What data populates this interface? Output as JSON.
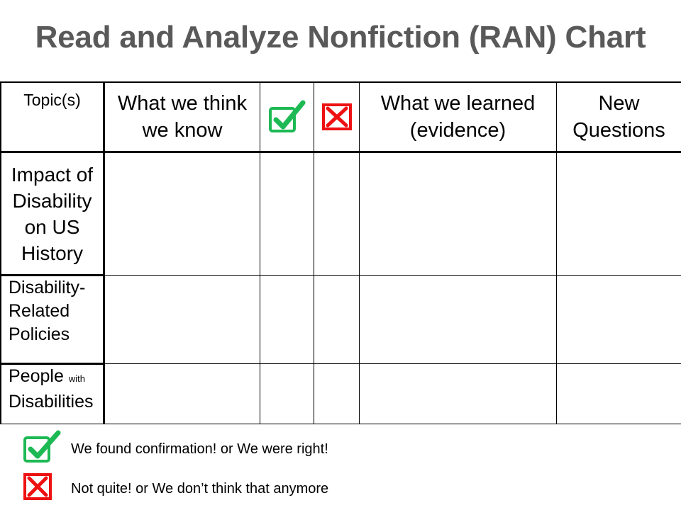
{
  "title": "Read and Analyze Nonfiction (RAN) Chart",
  "table": {
    "headers": {
      "topics": "Topic(s)",
      "think_line1": "What we think",
      "think_line2": "we know",
      "confirmed_icon": "green-check-box-icon",
      "rejected_icon": "red-x-box-icon",
      "learned_line1": "What we learned",
      "learned_line2": "(evidence)",
      "questions_line1": "New",
      "questions_line2": "Questions"
    },
    "rows": [
      {
        "topic_lines": [
          "Impact of",
          "Disability",
          "on US",
          "History"
        ]
      },
      {
        "topic_lines": [
          "Disability-",
          "Related",
          "Policies"
        ]
      },
      {
        "topic_main": "People",
        "topic_small": "with",
        "topic_line2": "Disabilities"
      }
    ]
  },
  "legend": [
    {
      "icon": "green-check-box-icon",
      "text": "We found confirmation! or We were right!"
    },
    {
      "icon": "red-x-box-icon",
      "text": "Not quite! or We don’t think that anymore"
    }
  ],
  "colors": {
    "title": "#595959",
    "check_green": "#1db954",
    "x_red": "#ee1111"
  }
}
